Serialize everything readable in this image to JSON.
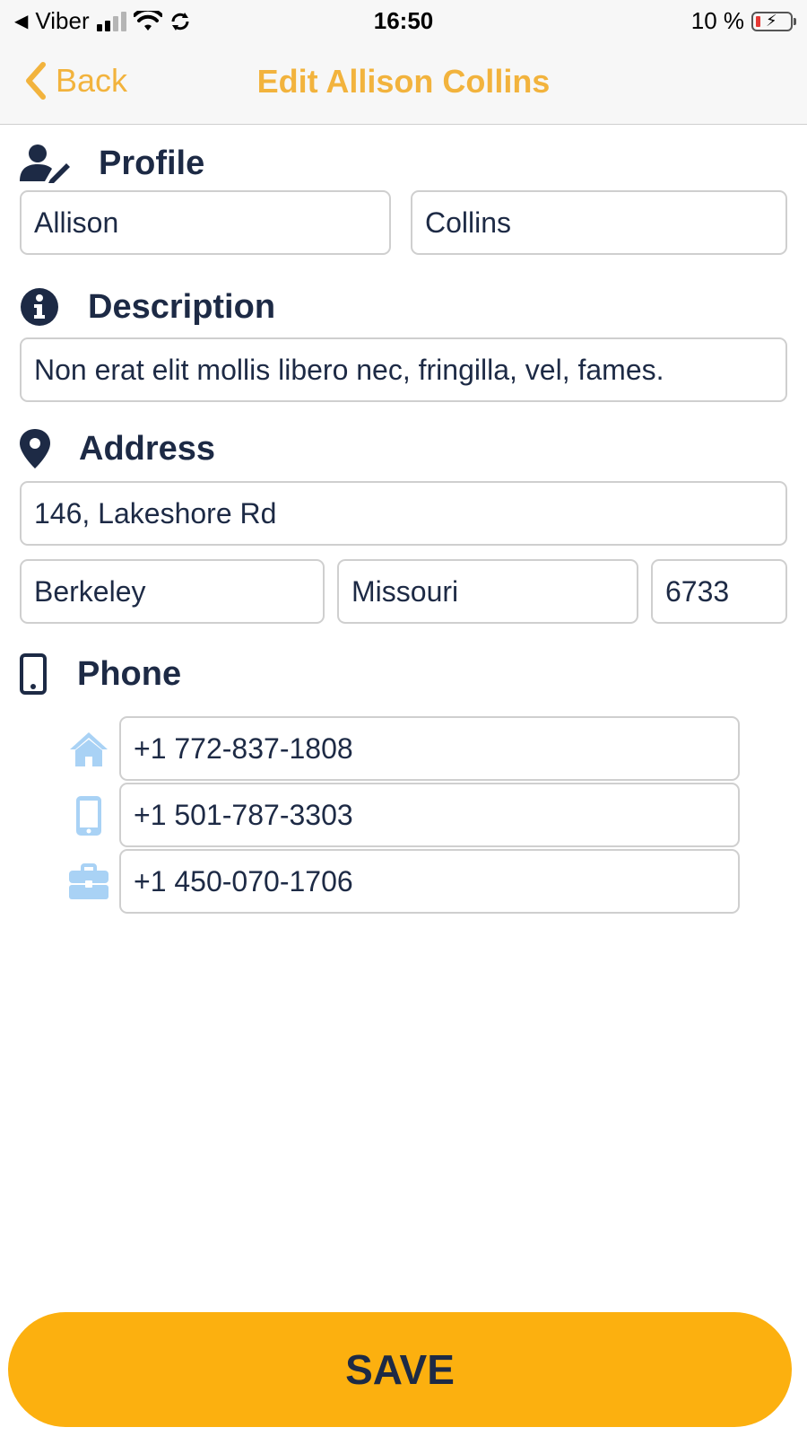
{
  "status_bar": {
    "carrier": "Viber",
    "time": "16:50",
    "battery_percent": "10 %",
    "icons": [
      "back-arrow-icon",
      "signal-icon",
      "wifi-icon",
      "sync-icon",
      "battery-charging-icon"
    ]
  },
  "nav": {
    "back_label": "Back",
    "title": "Edit Allison Collins",
    "accent_color": "#f2b33d"
  },
  "profile": {
    "heading": "Profile",
    "first_name": "Allison",
    "last_name": "Collins"
  },
  "description": {
    "heading": "Description",
    "text": "Non erat elit mollis libero nec, fringilla, vel, fames."
  },
  "address": {
    "heading": "Address",
    "street": "146, Lakeshore Rd",
    "city": "Berkeley",
    "state": "Missouri",
    "zip": "6733"
  },
  "phone": {
    "heading": "Phone",
    "home": "+1 772-837-1808",
    "mobile": "+1 501-787-3303",
    "work": "+1 450-070-1706",
    "icon_color": "#a9d2f5"
  },
  "save_button": {
    "label": "SAVE",
    "color": "#fcb00f"
  }
}
